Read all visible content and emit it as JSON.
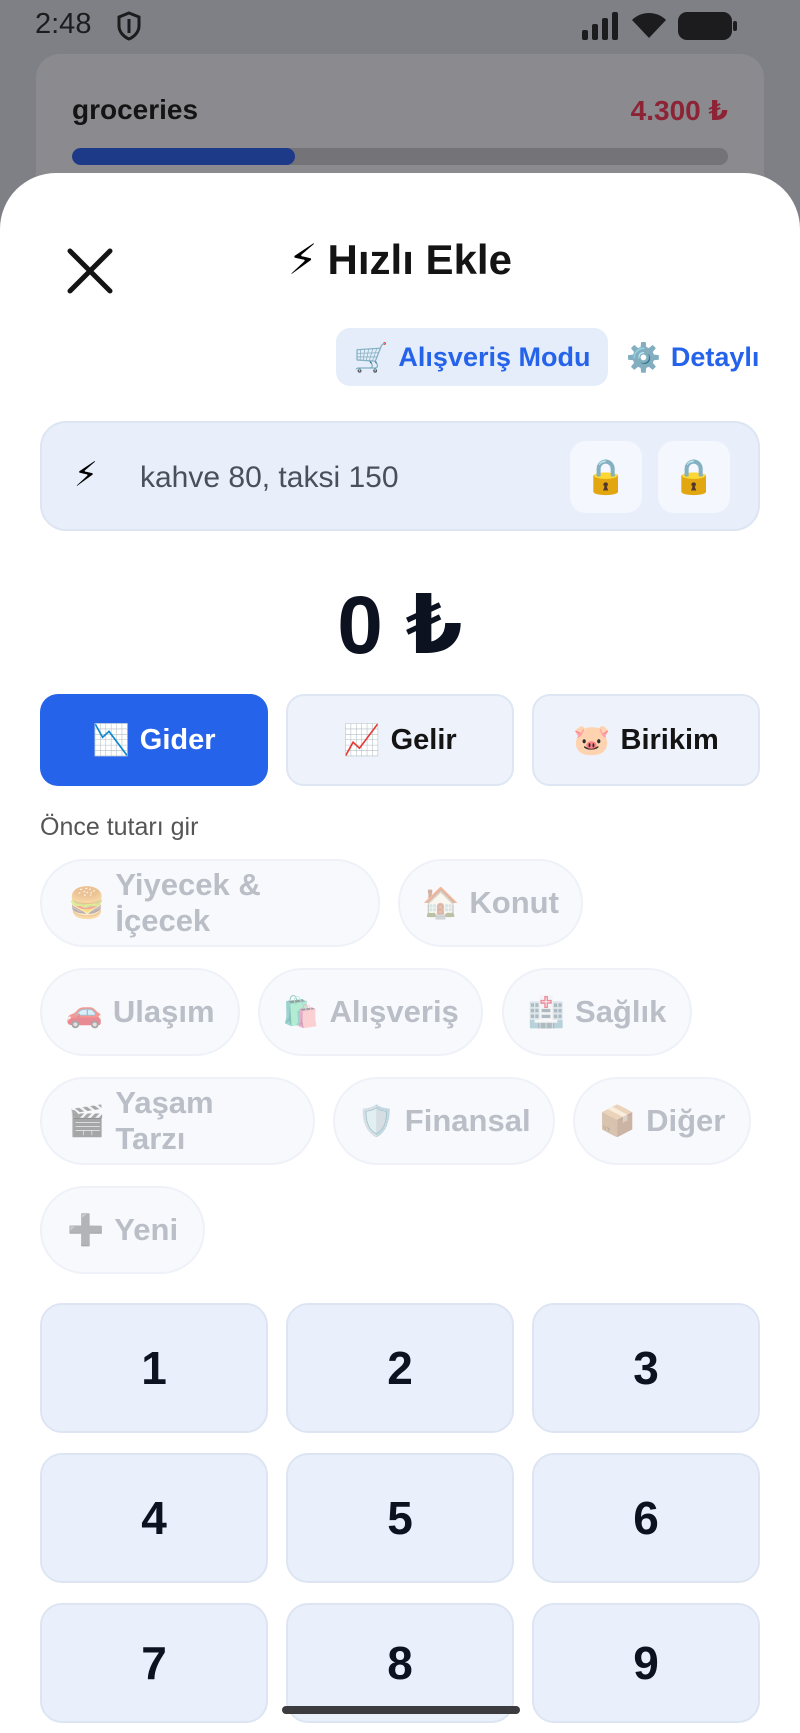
{
  "status_bar": {
    "time": "2:48"
  },
  "background": {
    "budget": {
      "name": "groceries",
      "amount": "4.300 ₺",
      "progress_pct": 34
    }
  },
  "sheet": {
    "title": "Hızlı Ekle",
    "shopping_mode_label": "Alışveriş Modu",
    "detailed_label": "Detaylı",
    "quick_input": {
      "placeholder": "kahve 80, taksi 150"
    },
    "amount": "0 ₺",
    "types": [
      {
        "label": "Gider",
        "icon": "📉",
        "active": true
      },
      {
        "label": "Gelir",
        "icon": "📈",
        "active": false
      },
      {
        "label": "Birikim",
        "icon": "🐷",
        "active": false
      }
    ],
    "hint": "Önce tutarı gir",
    "categories": [
      {
        "label": "Yiyecek & İçecek",
        "icon": "🍔"
      },
      {
        "label": "Konut",
        "icon": "🏠"
      },
      {
        "label": "Ulaşım",
        "icon": "🚗"
      },
      {
        "label": "Alışveriş",
        "icon": "🛍️"
      },
      {
        "label": "Sağlık",
        "icon": "🏥"
      },
      {
        "label": "Yaşam Tarzı",
        "icon": "🎬"
      },
      {
        "label": "Finansal",
        "icon": "🛡️"
      },
      {
        "label": "Diğer",
        "icon": "📦"
      },
      {
        "label": "Yeni",
        "icon": "➕"
      }
    ],
    "keypad": [
      "1",
      "2",
      "3",
      "4",
      "5",
      "6",
      "7",
      "8",
      "9"
    ]
  }
}
